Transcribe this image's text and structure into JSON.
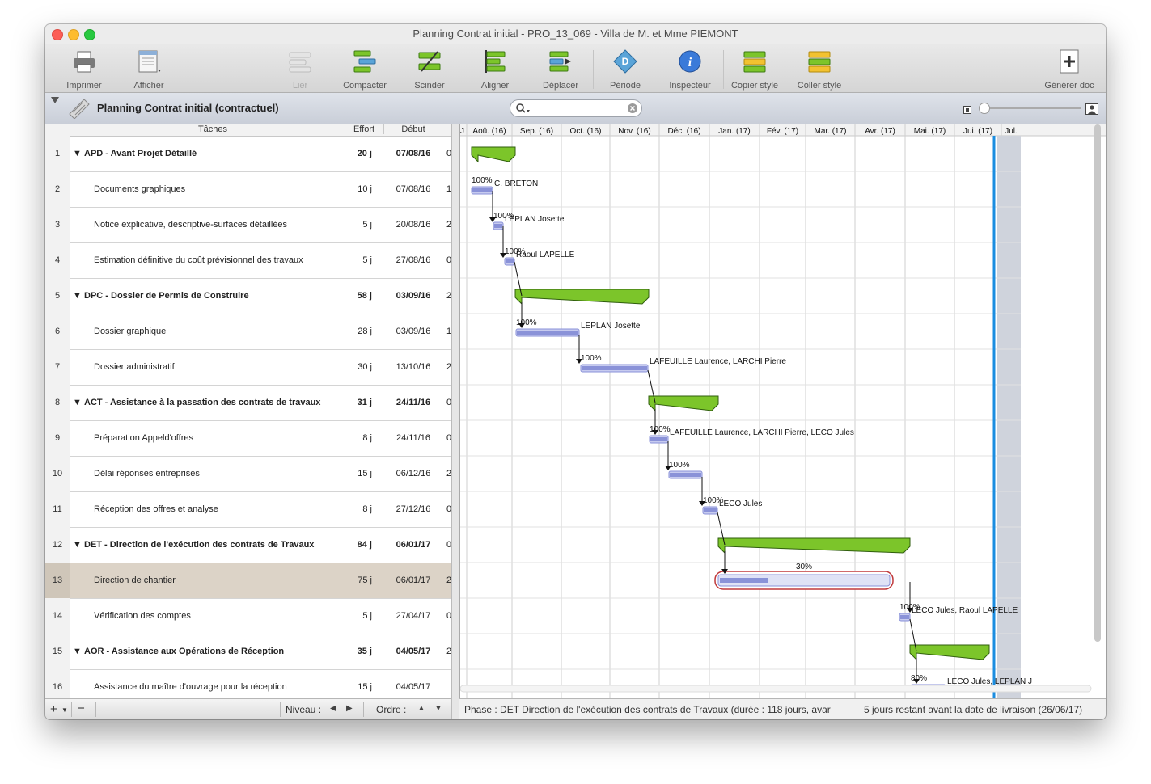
{
  "window": {
    "title": "Planning Contrat initial - PRO_13_069 - Villa de M. et Mme PIEMONT"
  },
  "toolbar": {
    "items": [
      {
        "label": "Imprimer",
        "icon": "printer-icon"
      },
      {
        "label": "Afficher",
        "icon": "view-icon"
      },
      {
        "label": "Lier",
        "icon": "link-icon",
        "disabled": true
      },
      {
        "label": "Compacter",
        "icon": "compact-icon"
      },
      {
        "label": "Scinder",
        "icon": "split-icon"
      },
      {
        "label": "Aligner",
        "icon": "align-icon"
      },
      {
        "label": "Déplacer",
        "icon": "move-icon"
      },
      {
        "label": "Période",
        "icon": "period-icon"
      },
      {
        "label": "Inspecteur",
        "icon": "inspector-icon"
      },
      {
        "label": "Copier style",
        "icon": "copy-style-icon"
      },
      {
        "label": "Coller style",
        "icon": "paste-style-icon"
      },
      {
        "label": "Générer doc",
        "icon": "generate-doc-icon"
      }
    ]
  },
  "header": {
    "plan_title": "Planning Contrat initial (contractuel)"
  },
  "table": {
    "columns": {
      "tasks": "Tâches",
      "effort": "Effort",
      "debut": "Début"
    },
    "rows": [
      {
        "num": "1",
        "name": "APD - Avant Projet Détaillé",
        "effort": "20 j",
        "debut": "07/08/16",
        "trunc": "0",
        "group": true
      },
      {
        "num": "2",
        "name": "Documents graphiques",
        "effort": "10 j",
        "debut": "07/08/16",
        "trunc": "1"
      },
      {
        "num": "3",
        "name": "Notice explicative, descriptive-surfaces détaillées",
        "effort": "5 j",
        "debut": "20/08/16",
        "trunc": "2"
      },
      {
        "num": "4",
        "name": "Estimation définitive du coût prévisionnel des travaux",
        "effort": "5 j",
        "debut": "27/08/16",
        "trunc": "0"
      },
      {
        "num": "5",
        "name": "DPC - Dossier de Permis de Construire",
        "effort": "58 j",
        "debut": "03/09/16",
        "trunc": "2",
        "group": true
      },
      {
        "num": "6",
        "name": "Dossier graphique",
        "effort": "28 j",
        "debut": "03/09/16",
        "trunc": "1"
      },
      {
        "num": "7",
        "name": "Dossier administratif",
        "effort": "30 j",
        "debut": "13/10/16",
        "trunc": "2"
      },
      {
        "num": "8",
        "name": "ACT - Assistance à la passation des contrats de travaux",
        "effort": "31 j",
        "debut": "24/11/16",
        "trunc": "0",
        "group": true
      },
      {
        "num": "9",
        "name": "Préparation Appeld'offres",
        "effort": "8 j",
        "debut": "24/11/16",
        "trunc": "0"
      },
      {
        "num": "10",
        "name": "Délai réponses entreprises",
        "effort": "15 j",
        "debut": "06/12/16",
        "trunc": "2"
      },
      {
        "num": "11",
        "name": "Réception des offres et analyse",
        "effort": "8 j",
        "debut": "27/12/16",
        "trunc": "0"
      },
      {
        "num": "12",
        "name": "DET - Direction de l'exécution des contrats de Travaux",
        "effort": "84 j",
        "debut": "06/01/17",
        "trunc": "0",
        "group": true
      },
      {
        "num": "13",
        "name": "Direction de chantier",
        "effort": "75 j",
        "debut": "06/01/17",
        "trunc": "2",
        "selected": true
      },
      {
        "num": "14",
        "name": "Vérification des comptes",
        "effort": "5 j",
        "debut": "27/04/17",
        "trunc": "0"
      },
      {
        "num": "15",
        "name": "AOR - Assistance aux Opérations de Réception",
        "effort": "35 j",
        "debut": "04/05/17",
        "trunc": "2",
        "group": true
      },
      {
        "num": "16",
        "name": "Assistance du maître d'ouvrage pour la réception",
        "effort": "15 j",
        "debut": "04/05/17",
        "trunc": ""
      }
    ]
  },
  "gantt": {
    "months": [
      "Aoû. (16)",
      "Sep. (16)",
      "Oct. (16)",
      "Nov. (16)",
      "Déc. (16)",
      "Jan. (17)",
      "Fév. (17)",
      "Mar. (17)",
      "Avr. (17)",
      "Mai. (17)",
      "Jui. (17)",
      "Jul."
    ],
    "first_col_label": "J",
    "labels": {
      "r2_pct": "100%",
      "r2_res": "C. BRETON",
      "r3_pct": "100%",
      "r3_res": "LEPLAN Josette",
      "r4_pct": "100%",
      "r4_res": "Raoul LAPELLE",
      "r6_pct": "100%",
      "r6_res": "LEPLAN Josette",
      "r7_pct": "100%",
      "r7_res": "LAFEUILLE Laurence, LARCHI Pierre",
      "r9_pct": "100%",
      "r9_res": "LAFEUILLE Laurence, LARCHI Pierre, LECO Jules",
      "r10_pct": "100%",
      "r11_pct": "100%",
      "r11_res": "LECO Jules",
      "r13_pct": "30%",
      "r14_pct": "100%",
      "r14_res": "LECO Jules, Raoul LAPELLE",
      "r16_pct": "80%",
      "r16_res": "LECO Jules, LEPLAN J"
    }
  },
  "statusbar": {
    "add": "+",
    "remove": "−",
    "niveau": "Niveau :",
    "ordre": "Ordre :",
    "phase": "Phase : DET Direction de l'exécution des contrats de Travaux (durée : 118 jours, avar",
    "remaining": "5 jours restant avant la date de livraison (26/06/17)"
  },
  "colors": {
    "group_bar": "#7cc52a",
    "task_bar": "#8a92d8",
    "selected_outline": "#c0393b",
    "today_line": "#1b8de0"
  }
}
